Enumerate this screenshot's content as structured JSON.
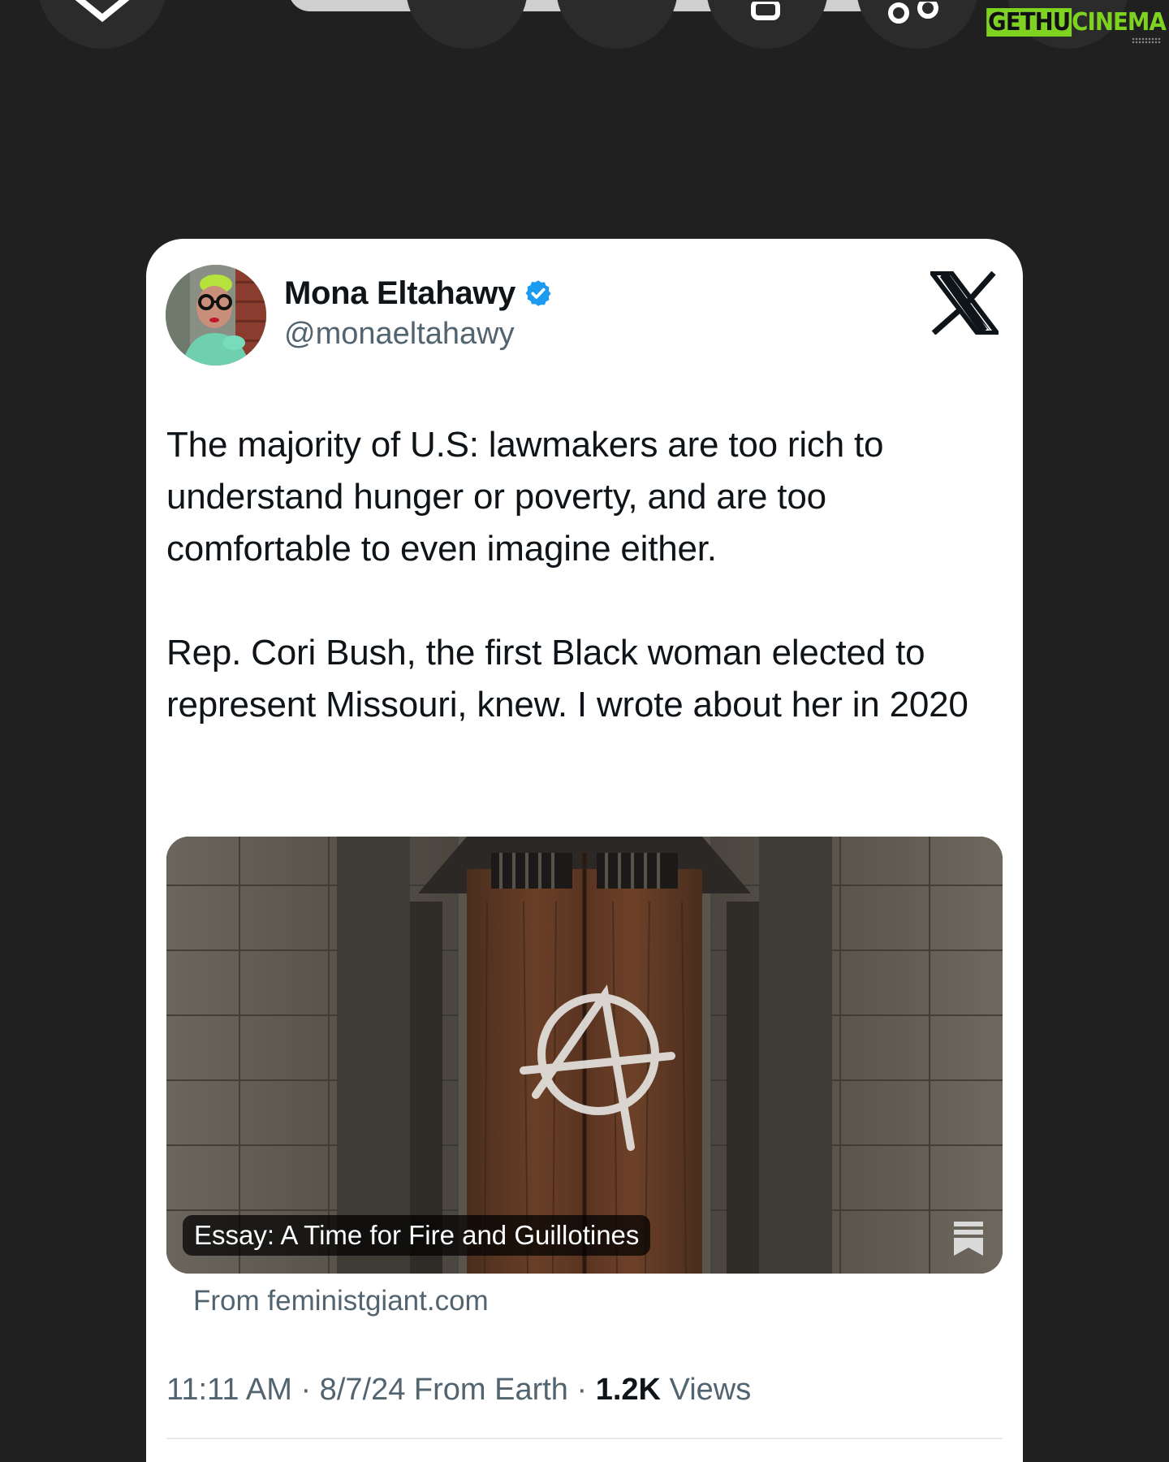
{
  "tweet": {
    "display_name": "Mona Eltahawy",
    "handle": "@monaeltahawy",
    "verified": true,
    "text": "The majority of U.S: lawmakers are too rich to understand hunger or poverty, and are too comfortable to even imagine either.\n\nRep. Cori Bush, the first Black woman elected to represent Missouri, knew. I wrote about her in 2020",
    "link_card": {
      "title": "Essay: A Time for Fire and Guillotines",
      "source": "From feministgiant.com"
    },
    "meta": {
      "timestamp": "11:11 AM · 8/7/24 From Earth · ",
      "views_count": "1.2K",
      "views_label": " Views"
    }
  },
  "watermark": {
    "part_a": "GETHU",
    "part_b": "CINEMA"
  },
  "colors": {
    "background": "#202020",
    "card": "#ffffff",
    "verified_blue": "#1d9bf0",
    "text_primary": "#0f1419",
    "text_secondary": "#536471",
    "watermark_green": "#7ed321"
  },
  "icons": [
    "close-icon",
    "x-logo-icon",
    "verified-badge-icon",
    "bookmark-icon",
    "share-icon",
    "link-icon"
  ]
}
